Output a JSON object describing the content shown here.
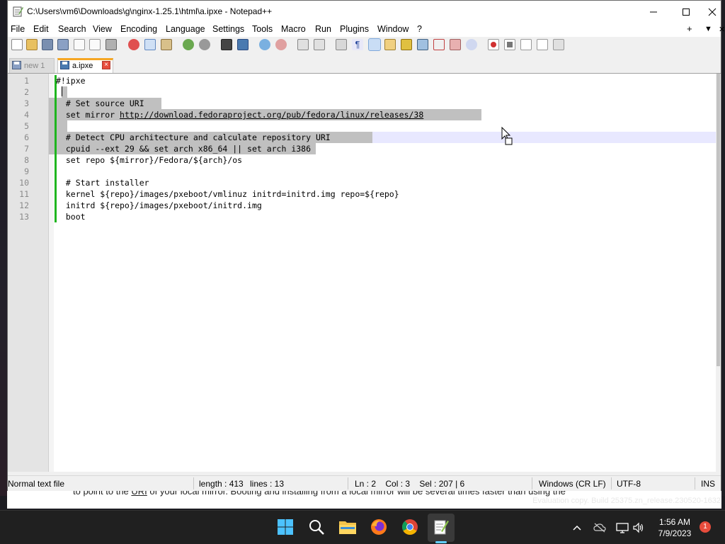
{
  "window": {
    "title": "C:\\Users\\vm6\\Downloads\\g\\nginx-1.25.1\\html\\a.ipxe - Notepad++",
    "min_glyph": "—",
    "max_glyph": "☐",
    "close_glyph": "✕"
  },
  "menu": {
    "items": [
      "File",
      "Edit",
      "Search",
      "View",
      "Encoding",
      "Language",
      "Settings",
      "Tools",
      "Macro",
      "Run",
      "Plugins",
      "Window",
      "?"
    ],
    "plus": "+",
    "dropdown": "▼",
    "close": "✕"
  },
  "tabs": [
    {
      "label": "new 1",
      "active": false
    },
    {
      "label": "a.ipxe",
      "active": true
    }
  ],
  "editor": {
    "line_numbers": [
      "1",
      "2",
      "3",
      "4",
      "5",
      "6",
      "7",
      "8",
      "9",
      "10",
      "11",
      "12",
      "13"
    ],
    "lines": [
      "#!ipxe",
      "",
      "  # Set source URI",
      "  set mirror ",
      "",
      "  # Detect CPU architecture and calculate repository URI",
      "  cpuid --ext 29 && set arch x86_64 || set arch i386",
      "  set repo ${mirror}/Fedora/${arch}/os",
      "",
      "  # Start installer",
      "  kernel ${repo}/images/pxeboot/vmlinuz initrd=initrd.img repo=${repo}",
      "  initrd ${repo}/images/pxeboot/initrd.img",
      "  boot"
    ],
    "mirror_url": "http://download.fedoraproject.org/pub/fedora/linux/releases/38"
  },
  "status": {
    "file_type": "Normal text file",
    "length": "length : 413",
    "lines": "lines : 13",
    "position": "Ln : 2    Col : 3    Sel : 207 | 6",
    "eol": "Windows (CR LF)",
    "encoding": "UTF-8",
    "mode": "INS"
  },
  "background": {
    "text_before": "to point to the ",
    "text_link": "URI",
    "text_after": " of your local mirror. Booting and installing from a local mirror will be several times faster than using the",
    "evaluation": "Evaluation copy. Build 25375.zn_release.230520-1632"
  },
  "taskbar": {
    "time": "1:56 AM",
    "date": "7/9/2023",
    "notification_count": "1"
  },
  "colors": {
    "selection": "#c0c0c0",
    "current_line": "#e8e8ff",
    "change_bar": "#1fb51f",
    "tab_accent": "#f5a623"
  }
}
